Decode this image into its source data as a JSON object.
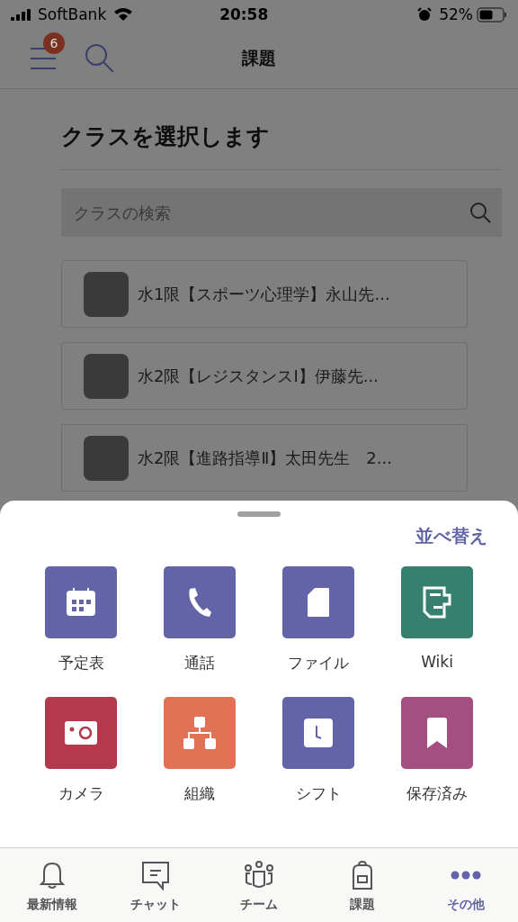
{
  "status_bar": {
    "carrier": "SoftBank",
    "time": "20:58",
    "battery": "52%"
  },
  "header": {
    "title": "課題",
    "badge": "6"
  },
  "class_picker": {
    "title": "クラスを選択します",
    "search": {
      "placeholder": "クラスの検索"
    },
    "classes": [
      {
        "name": "水1限【スポーツ心理学】永山先..."
      },
      {
        "name": "水2限【レジスタンスⅠ】伊藤先..."
      },
      {
        "name": "水2限【進路指導Ⅱ】太田先生　2..."
      }
    ]
  },
  "sheet": {
    "sort_button": "並べ替え",
    "apps": [
      {
        "label": "予定表",
        "kind": "calendar",
        "color": "#6264a7"
      },
      {
        "label": "通話",
        "kind": "phone",
        "color": "#6264a7"
      },
      {
        "label": "ファイル",
        "kind": "file",
        "color": "#6264a7"
      },
      {
        "label": "Wiki",
        "kind": "wiki",
        "color": "#37806f"
      },
      {
        "label": "カメラ",
        "kind": "camera",
        "color": "#b5394c"
      },
      {
        "label": "組織",
        "kind": "org",
        "color": "#e07155"
      },
      {
        "label": "シフト",
        "kind": "shift",
        "color": "#6264a7"
      },
      {
        "label": "保存済み",
        "kind": "bookmark",
        "color": "#a44f82"
      }
    ]
  },
  "tab_bar": [
    {
      "label": "最新情報",
      "kind": "bell",
      "selected": false
    },
    {
      "label": "チャット",
      "kind": "chat",
      "selected": false
    },
    {
      "label": "チーム",
      "kind": "team",
      "selected": false
    },
    {
      "label": "課題",
      "kind": "backpack",
      "selected": false
    },
    {
      "label": "その他",
      "kind": "more",
      "selected": true
    }
  ]
}
